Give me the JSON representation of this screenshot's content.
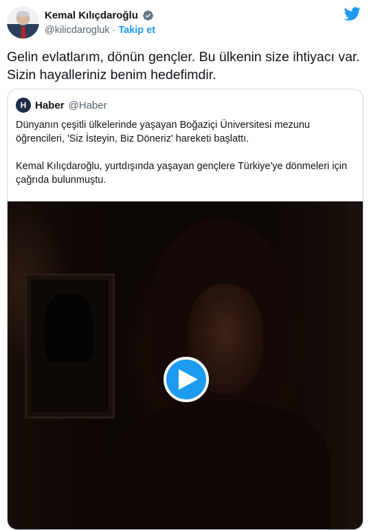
{
  "author": {
    "name": "Kemal Kılıçdaroğlu",
    "handle": "@kilicdarogluk",
    "separator": "·",
    "follow_label": "Takip et",
    "verified_icon": "verified-badge-icon"
  },
  "brand_icon": "twitter-bird-icon",
  "tweet": {
    "text": "Gelin evlatlarım, dönün gençler. Bu ülkenin size ihtiyacı var. Sizin hayalleriniz benim hedefimdir."
  },
  "quoted": {
    "avatar_letter": "H",
    "name": "Haber",
    "handle": "@Haber",
    "paragraphs": [
      "Dünyanın çeşitli ülkelerinde yaşayan Boğaziçi Üniversitesi mezunu öğrencileri, 'Siz İsteyin, Biz Döneriz' hareketi başlattı.",
      "Kemal Kılıçdaroğlu, yurtdışında yaşayan gençlere Türkiye'ye dönmeleri için çağrıda bulunmuştu."
    ]
  },
  "video": {
    "play_icon": "play-icon"
  },
  "colors": {
    "accent": "#1d9bf0",
    "text": "#0f1419",
    "muted": "#536471",
    "border": "#cfd9de"
  }
}
